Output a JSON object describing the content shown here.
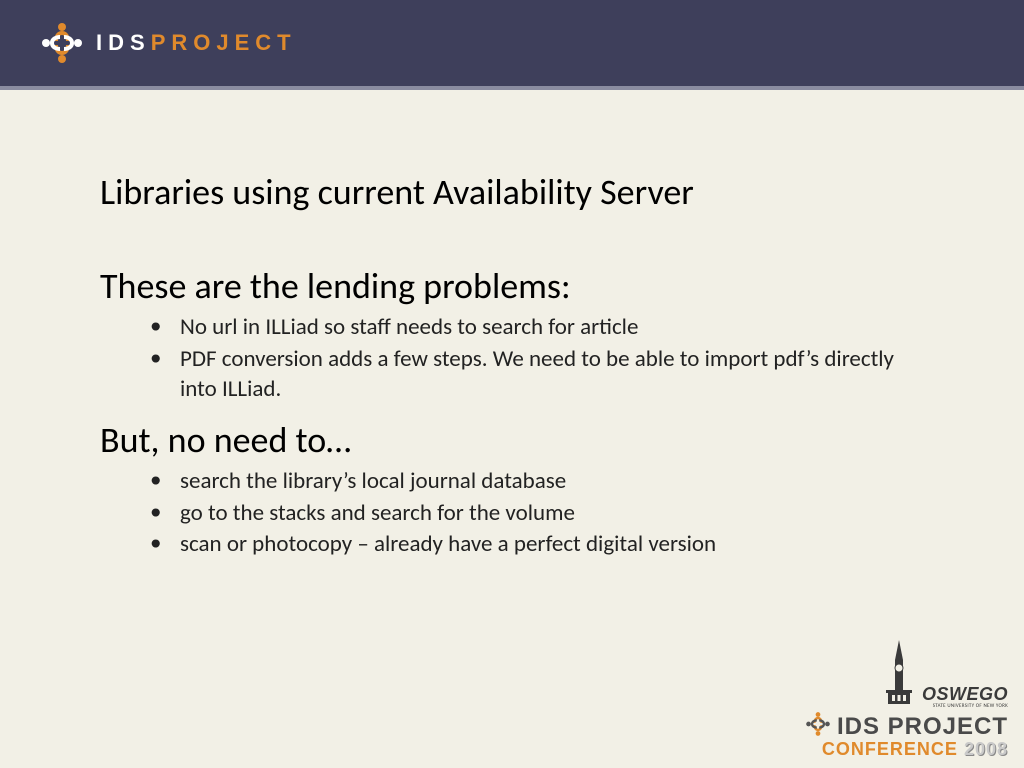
{
  "header": {
    "logo_ids": "IDS",
    "logo_project": "PROJECT"
  },
  "slide": {
    "title": "Libraries using current Availability Server",
    "section1_heading": "These are the lending problems:",
    "section1_items": [
      "No url in ILLiad so staff needs to search for article",
      "PDF conversion adds a few steps.  We need to be able to import pdf’s directly into ILLiad."
    ],
    "section2_heading": "But, no need to…",
    "section2_items": [
      "search the library’s local journal database",
      "go to the stacks and search for the volume",
      "scan or photocopy – already have a perfect digital version"
    ]
  },
  "footer": {
    "oswego": "OSWEGO",
    "oswego_sub": "STATE UNIVERSITY OF NEW YORK",
    "idsproject": "IDS PROJECT",
    "conference": "CONFERENCE",
    "year": "2008"
  }
}
